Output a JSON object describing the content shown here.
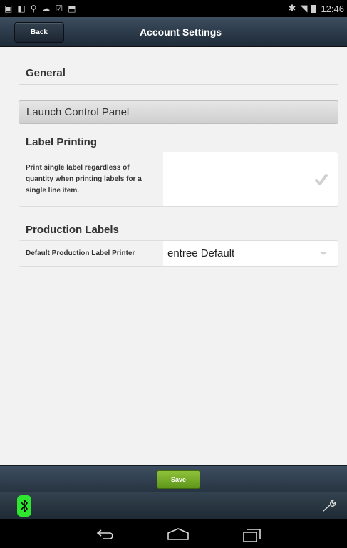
{
  "statusbar": {
    "time": "12:46"
  },
  "actionbar": {
    "back_label": "Back",
    "title": "Account Settings"
  },
  "sections": {
    "general": "General",
    "launch_button": "Launch Control Panel",
    "label_printing": "Label Printing",
    "print_single_label_text": "Print single label regardless of quantity when printing labels for a single line item.",
    "production_labels": "Production Labels",
    "default_printer_label": "Default Production Label Printer",
    "default_printer_value": "entree Default"
  },
  "footer": {
    "save_label": "Save"
  },
  "icons": {
    "check": "checkmark-icon",
    "dropdown": "chevron-down-icon",
    "bluetooth": "bluetooth-icon",
    "wrench": "wrench-icon",
    "back": "back-nav-icon",
    "home": "home-nav-icon",
    "recents": "recents-nav-icon"
  },
  "colors": {
    "actionbar": "#2a3847",
    "save_green": "#6fa726",
    "bluetooth_green": "#2ee62e"
  }
}
